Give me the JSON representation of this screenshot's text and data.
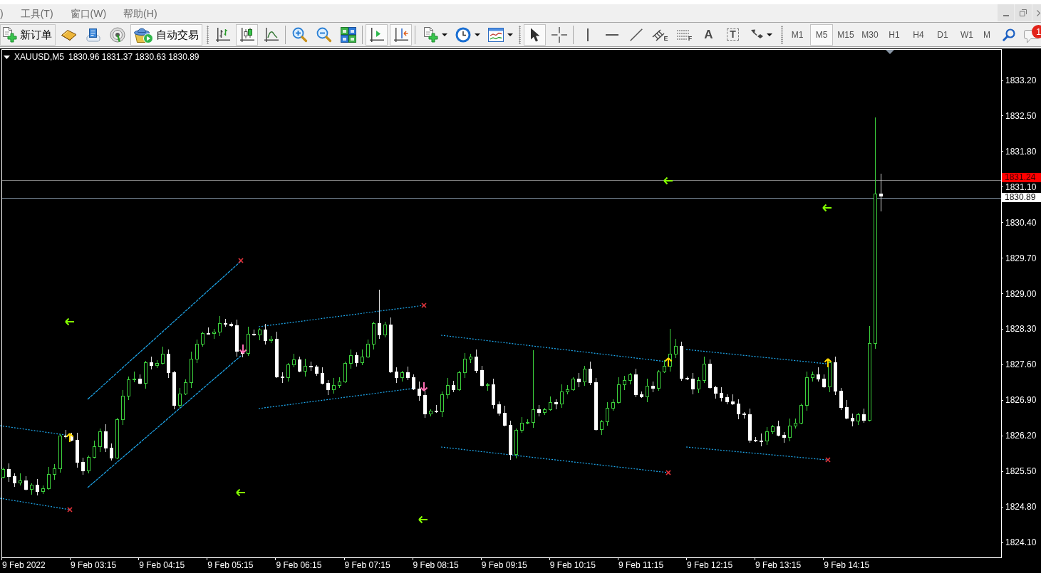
{
  "menu_bar": {
    "items": [
      {
        "label": ")"
      },
      {
        "label": "工具(T)"
      },
      {
        "label": "窗口(W)"
      },
      {
        "label": "帮助(H)"
      }
    ]
  },
  "toolbars": [
    {
      "groups": [
        [
          {
            "kind": "text",
            "label": "新订单",
            "pressed": false
          },
          {
            "kind": "icon",
            "pressed": false
          },
          {
            "kind": "icon",
            "pressed": false
          },
          {
            "kind": "icon",
            "pressed": false
          },
          {
            "kind": "text",
            "label": "自动交易",
            "pressed": true
          }
        ]
      ]
    },
    {
      "groups": [
        [
          {
            "kind": "icon",
            "pressed": false
          },
          {
            "kind": "icon",
            "pressed": true
          },
          {
            "kind": "icon",
            "pressed": false
          }
        ],
        [
          {
            "kind": "icon",
            "pressed": false
          },
          {
            "kind": "icon",
            "pressed": false
          },
          {
            "kind": "icon",
            "pressed": false
          }
        ],
        [
          {
            "kind": "icon",
            "pressed": true
          },
          {
            "kind": "icon",
            "pressed": true
          }
        ],
        [
          {
            "kind": "menu",
            "pressed": false
          },
          {
            "kind": "menu",
            "pressed": false
          },
          {
            "kind": "menu",
            "pressed": false
          }
        ]
      ]
    },
    {
      "groups": [
        [
          {
            "kind": "icon",
            "pressed": true
          },
          {
            "kind": "icon",
            "pressed": false
          }
        ],
        [
          {
            "kind": "icon",
            "pressed": false
          },
          {
            "kind": "icon",
            "pressed": false
          },
          {
            "kind": "icon",
            "pressed": false
          },
          {
            "kind": "icon",
            "pressed": false,
            "glyph": "E"
          },
          {
            "kind": "icon",
            "pressed": false,
            "glyph": "F"
          },
          {
            "kind": "glyph",
            "pressed": false,
            "glyph": "A"
          },
          {
            "kind": "glyph",
            "pressed": false,
            "glyph": "T"
          },
          {
            "kind": "menu",
            "pressed": false
          }
        ]
      ]
    }
  ],
  "timeframes": [
    {
      "label": "M1",
      "selected": false
    },
    {
      "label": "M5",
      "selected": true
    },
    {
      "label": "M15",
      "selected": false
    },
    {
      "label": "M30",
      "selected": false
    },
    {
      "label": "H1",
      "selected": false
    },
    {
      "label": "H4",
      "selected": false
    },
    {
      "label": "D1",
      "selected": false
    },
    {
      "label": "W1",
      "selected": false
    },
    {
      "label": "M",
      "selected": false
    }
  ],
  "right_buttons": [
    {
      "pressed": false
    },
    {
      "pressed": false,
      "badge": "1"
    }
  ],
  "chart": {
    "symbol": "XAUUSD,M5",
    "quotes": "1830.96 1831.37 1830.63 1830.89",
    "price_labels": [
      "1833.20",
      "1832.50",
      "1831.80",
      "1831.10",
      "1830.40",
      "1829.70",
      "1829.00",
      "1828.30",
      "1827.60",
      "1826.90",
      "1826.20",
      "1825.50",
      "1824.80",
      "1824.10"
    ],
    "price_tags": [
      {
        "kind": "alert",
        "label": "1831.24"
      },
      {
        "kind": "bid",
        "label": "1830.89"
      }
    ],
    "time_labels": [
      "9 Feb 2022",
      "9 Feb 03:15",
      "9 Feb 04:15",
      "9 Feb 05:15",
      "9 Feb 06:15",
      "9 Feb 07:15",
      "9 Feb 08:15",
      "9 Feb 09:15",
      "9 Feb 10:15",
      "9 Feb 11:15",
      "9 Feb 12:15",
      "9 Feb 13:15",
      "9 Feb 14:15"
    ]
  }
}
